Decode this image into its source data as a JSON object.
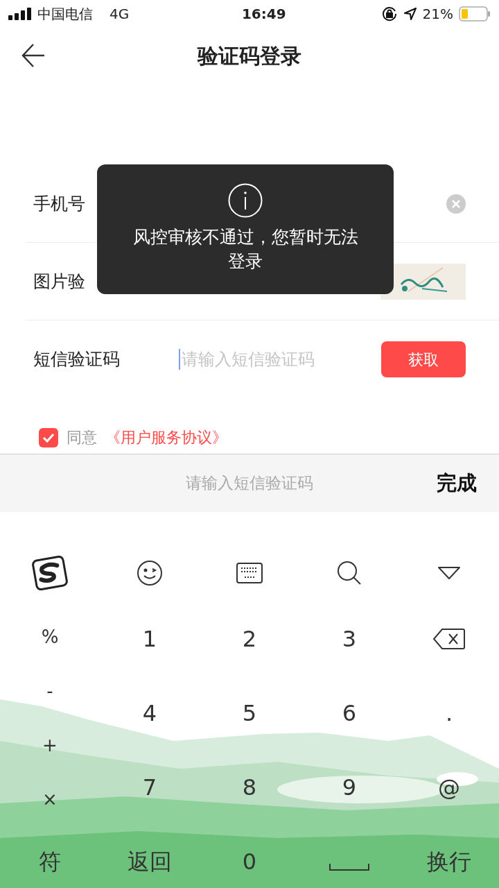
{
  "status_bar": {
    "carrier": "中国电信",
    "network": "4G",
    "time": "16:49",
    "battery": "21%"
  },
  "nav": {
    "title": "验证码登录"
  },
  "form": {
    "rows": [
      {
        "kind": "phone",
        "label": "手机号"
      },
      {
        "kind": "captcha",
        "label": "图片验"
      },
      {
        "kind": "sms",
        "label": "短信验证码",
        "placeholder": "请输入短信验证码",
        "button": "获取"
      }
    ]
  },
  "agreement": {
    "checked": true,
    "text": "同意",
    "link": "《用户服务协议》"
  },
  "toast": {
    "message": "风控审核不通过，您暂时无法登录"
  },
  "keyboard": {
    "toolbar": {
      "placeholder": "请输入短信验证码",
      "done": "完成"
    },
    "symbols": [
      "%",
      "-",
      "+",
      "×"
    ],
    "digits": [
      "1",
      "2",
      "3",
      "4",
      "5",
      "6",
      "7",
      "8",
      "9"
    ],
    "right_keys": [
      {
        "kind": "backspace"
      },
      {
        "kind": "text",
        "label": "."
      },
      {
        "kind": "text",
        "label": "@"
      }
    ],
    "bottom_keys": [
      {
        "kind": "text",
        "label": "符"
      },
      {
        "kind": "text",
        "label": "返回"
      },
      {
        "kind": "text",
        "label": "0"
      },
      {
        "kind": "space"
      },
      {
        "kind": "text",
        "label": "换行"
      }
    ]
  }
}
